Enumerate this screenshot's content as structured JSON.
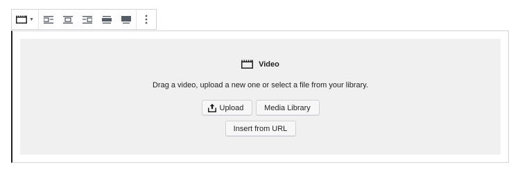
{
  "toolbar": {
    "block_switcher_icon": "video-icon",
    "caret_icon": "caret-down-icon",
    "alignments": [
      {
        "name": "align-left",
        "icon": "align-left-icon"
      },
      {
        "name": "align-center",
        "icon": "align-center-icon"
      },
      {
        "name": "align-right",
        "icon": "align-right-icon"
      },
      {
        "name": "align-wide",
        "icon": "align-wide-icon"
      },
      {
        "name": "align-full",
        "icon": "align-full-icon"
      }
    ],
    "more_icon": "more-vertical-icon"
  },
  "placeholder": {
    "icon": "video-icon",
    "title": "Video",
    "instructions": "Drag a video, upload a new one or select a file from your library.",
    "upload_label": "Upload",
    "upload_icon": "upload-icon",
    "media_library_label": "Media Library",
    "insert_url_label": "Insert from URL"
  },
  "colors": {
    "placeholder_bg": "#f0f0f0",
    "border": "#d2d6da",
    "text": "#1e1e1e"
  }
}
